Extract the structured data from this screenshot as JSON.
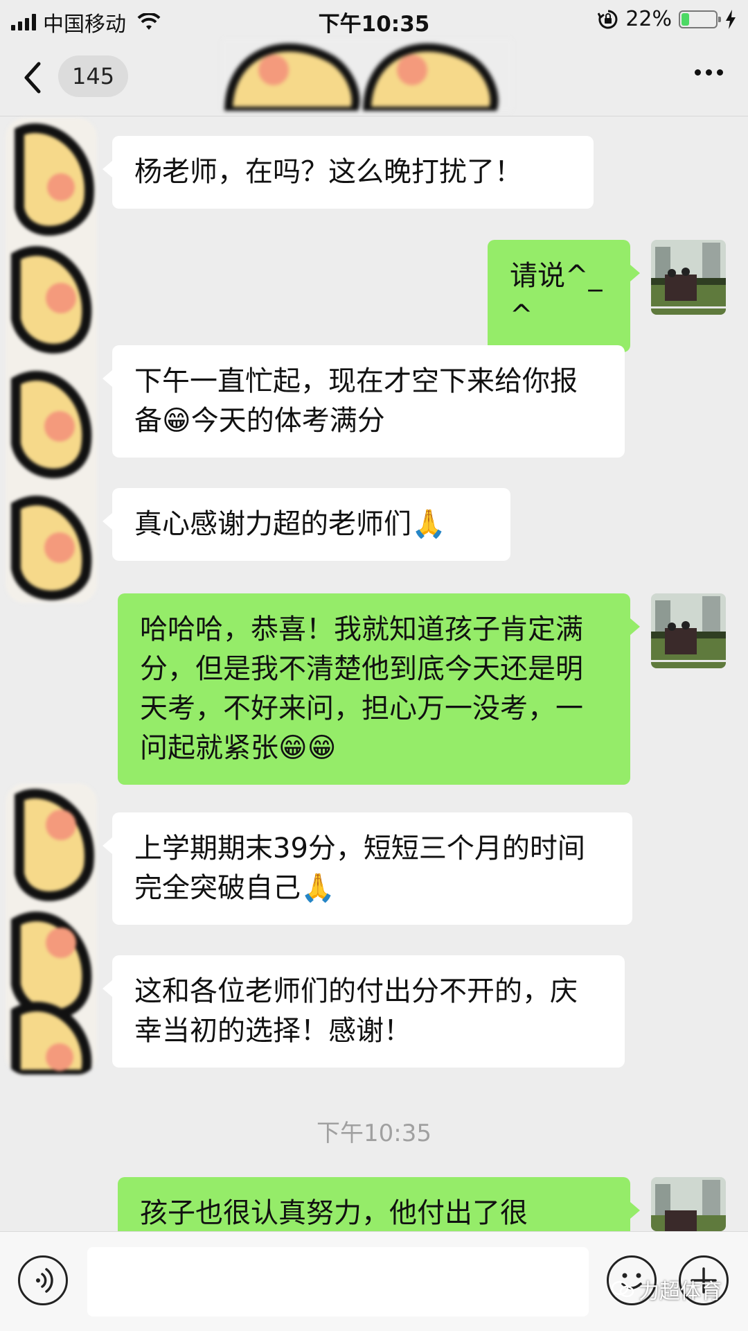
{
  "status_bar": {
    "carrier": "中国移动",
    "time": "下午10:35",
    "battery_percent": "22%",
    "battery_level": 0.22
  },
  "nav": {
    "unread_count": "145"
  },
  "messages": [
    {
      "side": "in",
      "text": "杨老师，在吗？这么晚打扰了！"
    },
    {
      "side": "out",
      "text": "请说^_^"
    },
    {
      "side": "in",
      "text": "下午一直忙起，现在才空下来给你报备😁今天的体考满分"
    },
    {
      "side": "in",
      "text": "真心感谢力超的老师们🙏"
    },
    {
      "side": "out",
      "text": "哈哈哈，恭喜！我就知道孩子肯定满分，但是我不清楚他到底今天还是明天考，不好来问，担心万一没考，一问起就紧张😁😁"
    },
    {
      "side": "in",
      "text": "上学期期末39分，短短三个月的时间完全突破自己🙏"
    },
    {
      "side": "in",
      "text": "这和各位老师们的付出分不开的，庆幸当初的选择！感谢！"
    },
    {
      "side": "out",
      "text": "孩子也很认真努力，他付出了很"
    }
  ],
  "timestamp": "下午10:35",
  "input": {
    "value": ""
  },
  "watermark": "力超体育",
  "icons": {
    "back": "chevron-left-icon",
    "more": "more-dots-icon",
    "voice": "voice-icon",
    "emoji": "emoji-icon",
    "plus": "plus-icon"
  },
  "colors": {
    "background": "#ededed",
    "incoming_bubble": "#ffffff",
    "outgoing_bubble": "#95ec69",
    "battery": "#4cd964"
  }
}
